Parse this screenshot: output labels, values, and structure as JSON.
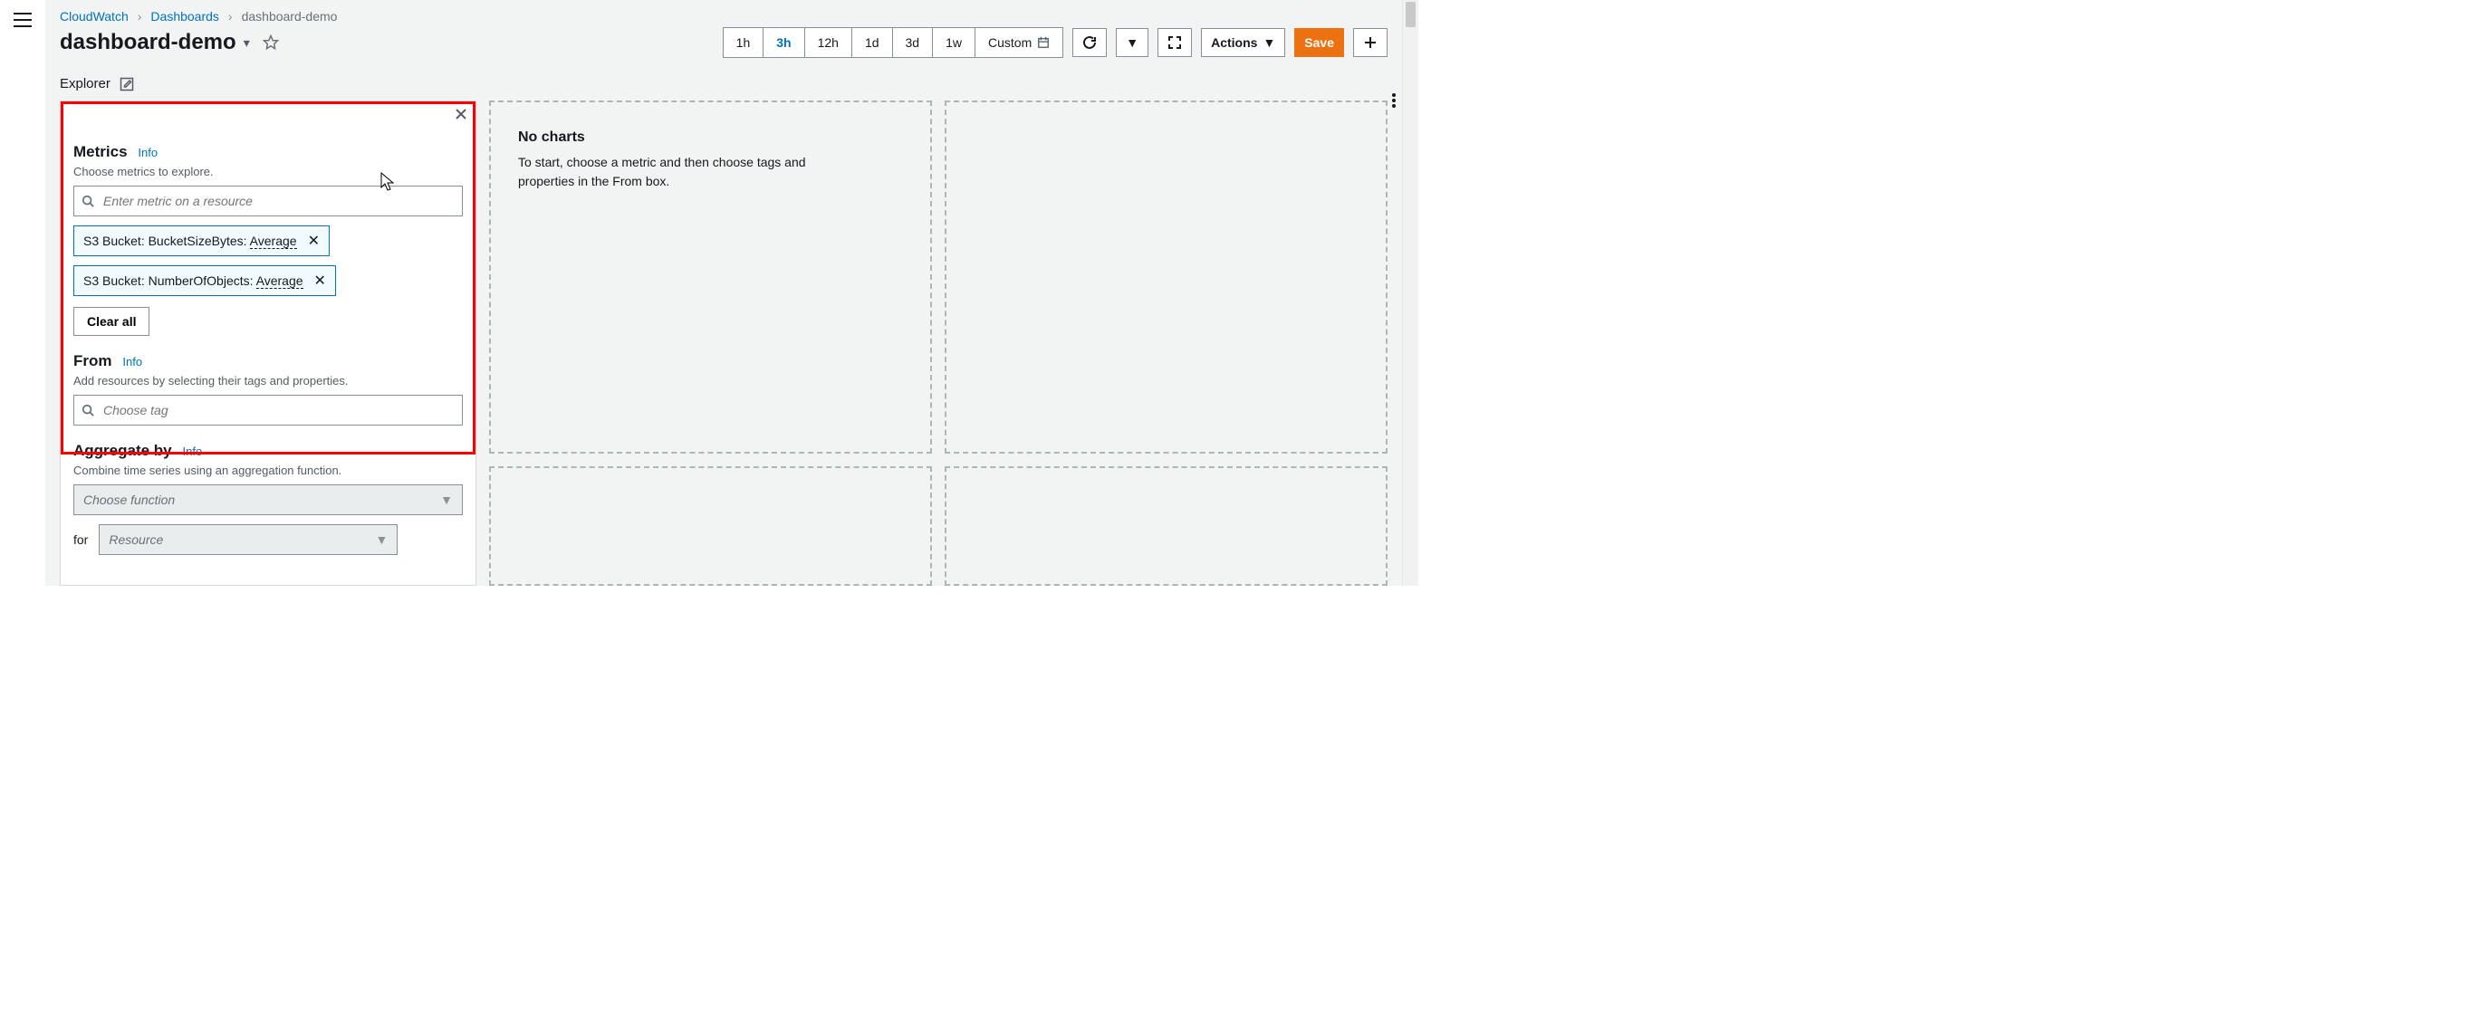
{
  "breadcrumbs": {
    "items": [
      "CloudWatch",
      "Dashboards"
    ],
    "current": "dashboard-demo"
  },
  "title": "dashboard-demo",
  "time_ranges": [
    "1h",
    "3h",
    "12h",
    "1d",
    "3d",
    "1w"
  ],
  "time_active": "3h",
  "custom_label": "Custom",
  "actions_label": "Actions",
  "save_label": "Save",
  "explorer_label": "Explorer",
  "metrics": {
    "heading": "Metrics",
    "info": "Info",
    "subtext": "Choose metrics to explore.",
    "placeholder": "Enter metric on a resource",
    "tokens": [
      {
        "prefix": "S3 Bucket: BucketSizeBytes: ",
        "stat": "Average"
      },
      {
        "prefix": "S3 Bucket: NumberOfObjects: ",
        "stat": "Average"
      }
    ],
    "clear": "Clear all"
  },
  "from": {
    "heading": "From",
    "info": "Info",
    "subtext": "Add resources by selecting their tags and properties.",
    "placeholder": "Choose tag"
  },
  "aggregate": {
    "heading": "Aggregate by",
    "info": "Info",
    "subtext": "Combine time series using an aggregation function.",
    "function_placeholder": "Choose function",
    "for_label": "for",
    "resource_placeholder": "Resource"
  },
  "empty": {
    "title": "No charts",
    "body": "To start, choose a metric and then choose tags and properties in the From box."
  }
}
